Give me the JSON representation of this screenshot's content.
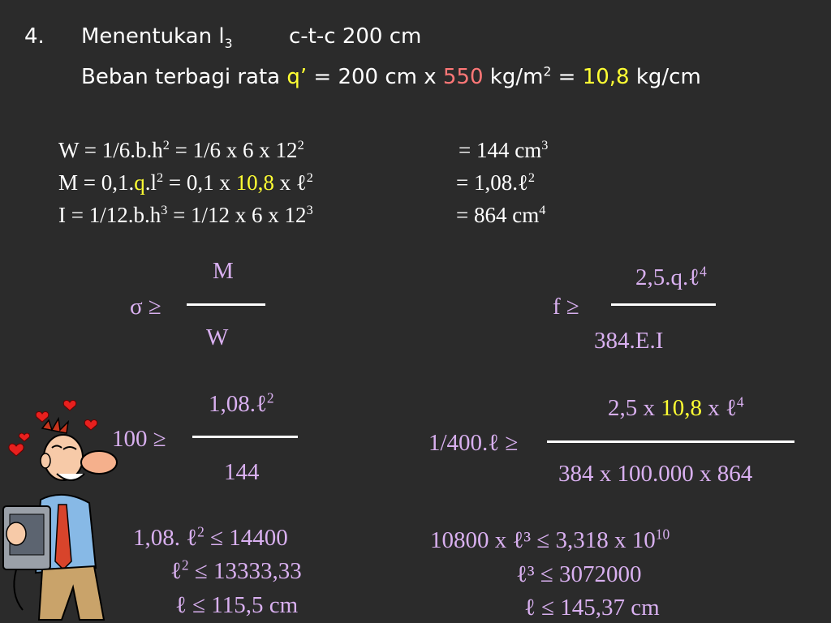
{
  "header": {
    "num": "4.",
    "line1_text": "Menentukan l",
    "line1_sub": "3",
    "line1_tail": "c-t-c  200 cm",
    "line2_a": "Beban terbagi rata ",
    "line2_q": "q’",
    "line2_b": " = 200 cm x ",
    "line2_550": "550",
    "line2_c": " kg/m",
    "line2_sup": "2",
    "line2_d": " = ",
    "line2_val": "10,8",
    "line2_e": " kg/cm"
  },
  "formulas": {
    "w_lhs": "W   = 1/6.b.h",
    "w_sup": "2",
    "w_mid": "  =  1/6 x 6 x 12",
    "w_sup2": "2",
    "w_res": "=  144 cm",
    "w_res_sup": "3",
    "m_lhs": "M   =  0,1.",
    "m_q": "q",
    "m_l": ".l",
    "m_sup": "2",
    "m_mid": "   =   0,1 x ",
    "m_val": "10,8",
    "m_mid2": " x ℓ",
    "m_sup2": "2",
    "m_res": "=  1,08.ℓ",
    "m_res_sup": "2",
    "i_lhs": "I     = 1/12.b.h",
    "i_sup": "3",
    "i_mid": "  =  1/12 x 6 x 12",
    "i_sup2": "3",
    "i_res": "=  864 cm",
    "i_res_sup": "4"
  },
  "sigma": {
    "lhs": "σ ≥",
    "num": "M",
    "den": "W"
  },
  "f": {
    "lhs": "f   ≥",
    "num": "2,5.q.ℓ",
    "num_sup": "4",
    "den": "384.E.I"
  },
  "left_calc": {
    "lhs": "100 ≥",
    "num": "1,08.ℓ",
    "num_sup": "2",
    "den": "144",
    "r1": "1,08. ℓ",
    "r1_sup": "2",
    "r1_b": "  ≤  14400",
    "r2": "ℓ",
    "r2_sup": "2",
    "r2_b": "  ≤  13333,33",
    "r3": "ℓ   ≤  115,5 cm"
  },
  "right_calc": {
    "lhs": "1/400.ℓ ≥",
    "num_a": "2,5 x ",
    "num_val": "10,8",
    "num_b": " x ℓ",
    "num_sup": "4",
    "den": "384 x 100.000 x 864",
    "r1": "10800 x ℓ³  ≤   3,318 x 10",
    "r1_sup": "10",
    "r2": "ℓ³  ≤   3072000",
    "r3": "ℓ   ≤   145,37 cm"
  },
  "colors": {
    "background": "#2b2b2b",
    "text": "#ffffff",
    "lavender": "#d9b0f0",
    "yellow": "#ffff33",
    "pink": "#ff7777"
  }
}
